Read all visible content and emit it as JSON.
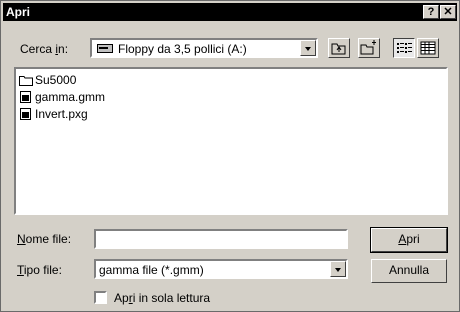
{
  "window": {
    "title": "Apri",
    "help_glyph": "?",
    "close_glyph": "✕"
  },
  "lookin": {
    "label_pre": "Cerca ",
    "label_ul": "i",
    "label_post": "n:",
    "value": "Floppy da 3,5 pollici (A:)",
    "icon": "floppy-drive-icon"
  },
  "toolbar": {
    "buttons": [
      "up-one-level-icon",
      "new-folder-icon",
      "list-view-icon",
      "details-view-icon"
    ]
  },
  "files": [
    {
      "name": "Su5000",
      "icon": "folder-icon"
    },
    {
      "name": "gamma.gmm",
      "icon": "document-icon"
    },
    {
      "name": "Invert.pxg",
      "icon": "document-icon"
    }
  ],
  "filename": {
    "label_ul": "N",
    "label_post": "ome file:",
    "value": ""
  },
  "filetype": {
    "label_ul": "T",
    "label_post": "ipo file:",
    "value": "gamma file (*.gmm)"
  },
  "buttons": {
    "open_ul": "A",
    "open_post": "pri",
    "cancel": "Annulla"
  },
  "readonly": {
    "pre": "Ap",
    "ul": "r",
    "post": "i in sola lettura",
    "checked": false
  }
}
